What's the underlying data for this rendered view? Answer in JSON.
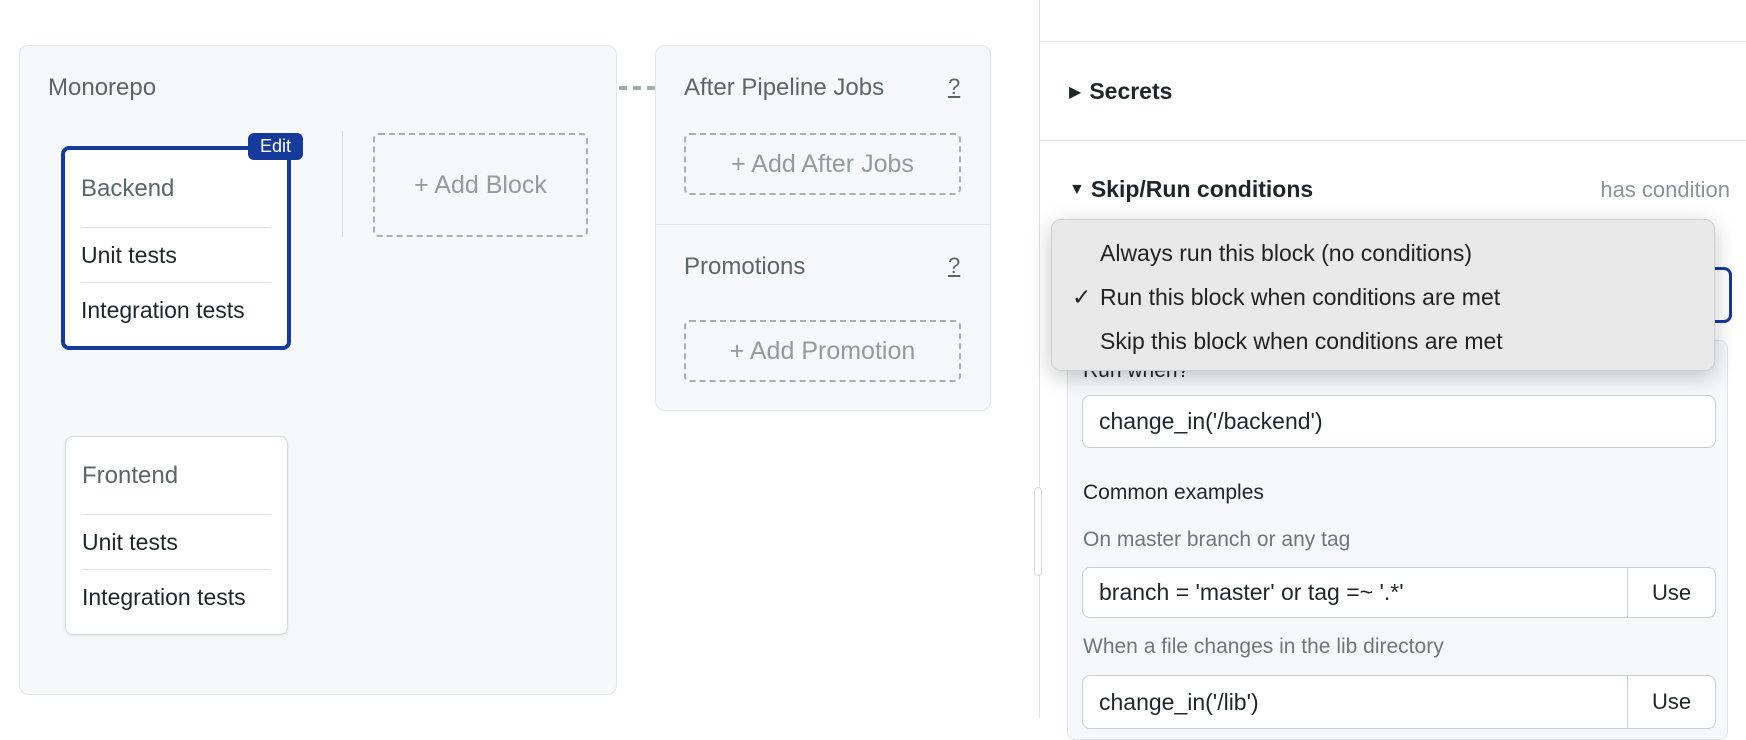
{
  "canvas": {
    "block_group": {
      "title": "Monorepo",
      "blocks": [
        {
          "name": "Backend",
          "jobs": [
            "Unit tests",
            "Integration tests"
          ],
          "selected": true,
          "badge": "Edit"
        },
        {
          "name": "Frontend",
          "jobs": [
            "Unit tests",
            "Integration tests"
          ],
          "selected": false
        }
      ],
      "add_block_label": "+ Add Block"
    },
    "after_pipeline": {
      "title": "After Pipeline Jobs",
      "help": "?",
      "add_label": "+ Add After Jobs"
    },
    "promotions": {
      "title": "Promotions",
      "help": "?",
      "add_label": "+ Add Promotion"
    }
  },
  "sidebar": {
    "secrets": {
      "title": "Secrets",
      "expanded": false
    },
    "skip_run": {
      "title": "Skip/Run conditions",
      "status": "has condition",
      "expanded": true,
      "dropdown_options": [
        {
          "label": "Always run this block (no conditions)",
          "checked": false
        },
        {
          "label": "Run this block when conditions are met",
          "checked": true
        },
        {
          "label": "Skip this block when conditions are met",
          "checked": false
        }
      ],
      "check_mark": "✓",
      "run_when_label": "Run when?",
      "run_when_value": "change_in('/backend')",
      "examples_title": "Common examples",
      "examples": [
        {
          "description": "On master branch or any tag",
          "value": "branch = 'master' or tag =~ '.*'",
          "button": "Use"
        },
        {
          "description": "When a file changes in the lib directory",
          "value": "change_in('/lib')",
          "button": "Use"
        }
      ]
    }
  },
  "colors": {
    "accent": "#163a9c",
    "panel_bg": "#f6f8fa",
    "menu_bg": "#e9e9e9"
  }
}
